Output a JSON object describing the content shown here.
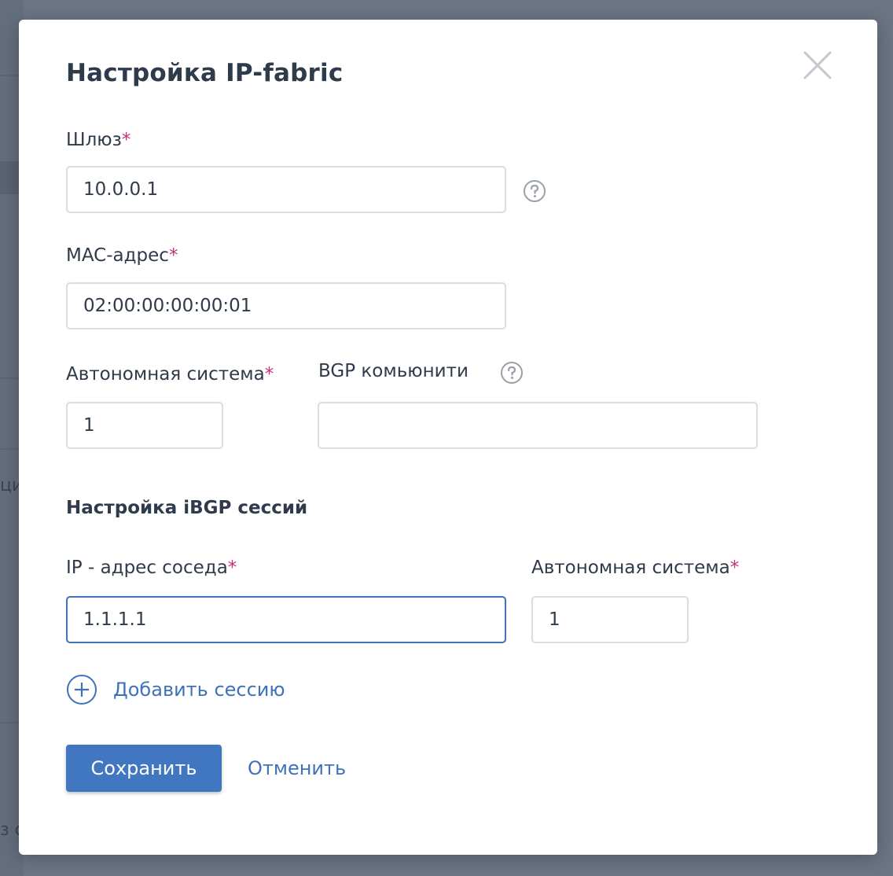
{
  "background": {
    "fragment_1": "ци",
    "fragment_2": "з о"
  },
  "modal": {
    "title": "Настройка IP-fabric",
    "close_icon": "close-icon",
    "gateway": {
      "label": "Шлюз",
      "required_mark": "*",
      "value": "10.0.0.1",
      "help_icon": "question-circle-icon"
    },
    "mac": {
      "label": "MAC-адрес",
      "required_mark": "*",
      "value": "02:00:00:00:00:01"
    },
    "as": {
      "label": "Автономная система",
      "required_mark": "*",
      "value": "1"
    },
    "bgp_community": {
      "label": "BGP комьюнити",
      "value": "",
      "help_icon": "question-circle-icon"
    },
    "ibgp_section_title": "Настройка iBGP сессий",
    "sessions": [
      {
        "neighbor_ip_label": "IP - адрес соседа",
        "neighbor_ip_required": "*",
        "neighbor_ip_value": "1.1.1.1",
        "as_label": "Автономная система",
        "as_required": "*",
        "as_value": "1"
      }
    ],
    "add_session_label": "Добавить сессию",
    "add_session_icon": "plus-circle-icon",
    "save_label": "Сохранить",
    "cancel_label": "Отменить"
  },
  "colors": {
    "accent": "#4177c0",
    "required": "#c4317a",
    "text": "#2f3a4b",
    "overlay": "#6b7585"
  }
}
